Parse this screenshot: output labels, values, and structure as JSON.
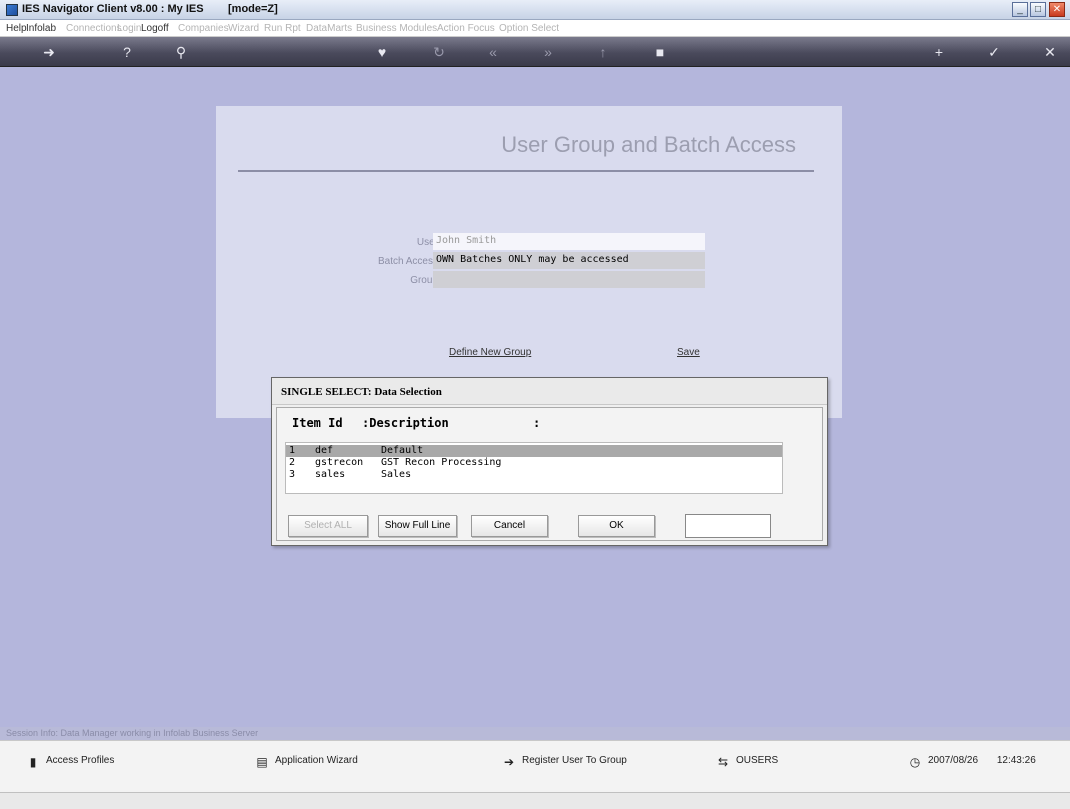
{
  "window": {
    "title": "IES Navigator Client v8.00 : My IES        [mode=Z]",
    "minimize_label": "_",
    "maximize_label": "□",
    "close_label": "✕"
  },
  "menu": {
    "items": [
      {
        "label": "Help",
        "enabled": true
      },
      {
        "label": "Infolab",
        "enabled": true
      },
      {
        "label": "Connections",
        "enabled": false
      },
      {
        "label": "Login",
        "enabled": false
      },
      {
        "label": "Logoff",
        "enabled": true
      },
      {
        "label": "Companies",
        "enabled": false
      },
      {
        "label": "Wizard",
        "enabled": false
      },
      {
        "label": "Run Rpt",
        "enabled": false
      },
      {
        "label": "DataMarts",
        "enabled": false
      },
      {
        "label": "Business Modules",
        "enabled": false
      },
      {
        "label": "Action Focus",
        "enabled": false
      },
      {
        "label": "Option Select",
        "enabled": false
      }
    ]
  },
  "toolbar": {
    "icons": [
      "arrow-right-icon",
      "help-icon",
      "search-icon",
      "heart-icon",
      "refresh-icon",
      "rewind-icon",
      "fast-forward-icon",
      "up-icon",
      "stop-icon",
      "add-icon",
      "check-icon",
      "close-icon"
    ]
  },
  "form": {
    "heading": "User Group and Batch Access",
    "user_label": "User",
    "user_value": "John Smith",
    "batch_label": "Batch Access",
    "batch_value": "OWN Batches ONLY may be accessed",
    "group_label": "Group",
    "group_value": "",
    "define_link": "Define New Group",
    "save_link": "Save"
  },
  "dialog": {
    "title": "SINGLE SELECT: Data Selection",
    "col_id": "Item Id",
    "col_desc": ":Description",
    "col_colon": ":",
    "rows": [
      {
        "num": "1",
        "id": "def",
        "desc": "Default"
      },
      {
        "num": "2",
        "id": "gstrecon",
        "desc": "GST Recon Processing"
      },
      {
        "num": "3",
        "id": "sales",
        "desc": "Sales"
      }
    ],
    "select_all": "Select ALL",
    "show_full": "Show Full Line",
    "cancel": "Cancel",
    "ok": "OK",
    "search_value": ""
  },
  "status": {
    "session": "Session Info: Data Manager working in Infolab Business Server"
  },
  "bottom": {
    "access_profiles": "Access Profiles",
    "app_wizard": "Application Wizard",
    "register": "Register User To Group",
    "users": "OUSERS",
    "date": "2007/08/26",
    "time": "12:43:26"
  }
}
